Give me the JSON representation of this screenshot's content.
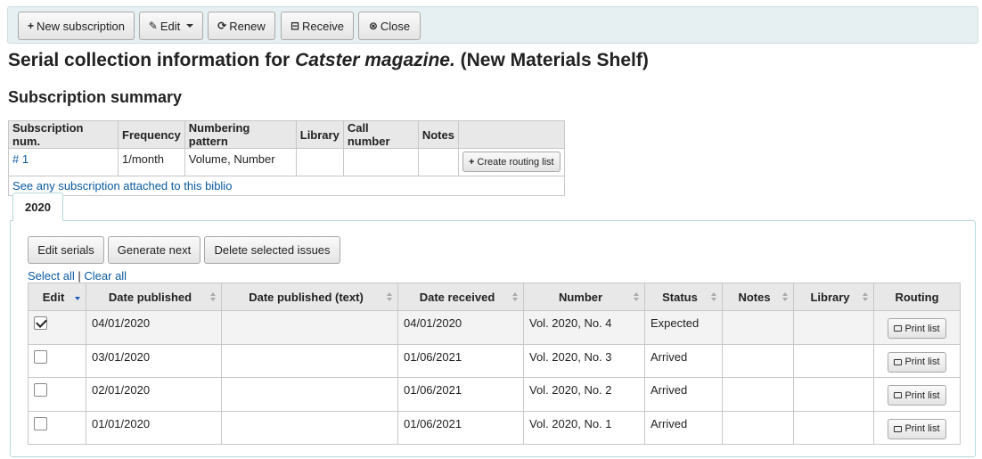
{
  "toolbar": {
    "new_subscription": "New subscription",
    "edit": "Edit",
    "renew": "Renew",
    "receive": "Receive",
    "close": "Close"
  },
  "title": {
    "prefix": "Serial collection information for",
    "biblio": "Catster magazine.",
    "suffix": "(New Materials Shelf)"
  },
  "summary": {
    "heading": "Subscription summary",
    "columns": [
      "Subscription num.",
      "Frequency",
      "Numbering pattern",
      "Library",
      "Call number",
      "Notes"
    ],
    "row": {
      "num": "# 1",
      "frequency": "1/month",
      "numbering": "Volume, Number",
      "library": "",
      "call_number": "",
      "notes": "",
      "routing_button": "Create routing list"
    },
    "footer_link": "See any subscription attached to this biblio"
  },
  "tabs": [
    "2020"
  ],
  "actions": {
    "edit_serials": "Edit serials",
    "generate_next": "Generate next",
    "delete_selected": "Delete selected issues"
  },
  "selection": {
    "select_all": "Select all",
    "separator": "|",
    "clear_all": "Clear all"
  },
  "issues": {
    "columns": [
      "Edit",
      "Date published",
      "Date published (text)",
      "Date received",
      "Number",
      "Status",
      "Notes",
      "Library",
      "Routing"
    ],
    "rows": [
      {
        "checked": true,
        "date_published": "04/01/2020",
        "date_text": "",
        "date_received": "04/01/2020",
        "number": "Vol. 2020, No. 4",
        "status": "Expected",
        "notes": "",
        "library": "",
        "routing": "Print list"
      },
      {
        "checked": false,
        "date_published": "03/01/2020",
        "date_text": "",
        "date_received": "01/06/2021",
        "number": "Vol. 2020, No. 3",
        "status": "Arrived",
        "notes": "",
        "library": "",
        "routing": "Print list"
      },
      {
        "checked": false,
        "date_published": "02/01/2020",
        "date_text": "",
        "date_received": "01/06/2021",
        "number": "Vol. 2020, No. 2",
        "status": "Arrived",
        "notes": "",
        "library": "",
        "routing": "Print list"
      },
      {
        "checked": false,
        "date_published": "01/01/2020",
        "date_text": "",
        "date_received": "01/06/2021",
        "number": "Vol. 2020, No. 1",
        "status": "Arrived",
        "notes": "",
        "library": "",
        "routing": "Print list"
      }
    ]
  },
  "colors": {
    "toolbar_bg": "#e6f0f2",
    "link": "#0a5aa0",
    "tab_border": "#b9d8d9",
    "sort_active": "#1a5bb8"
  }
}
